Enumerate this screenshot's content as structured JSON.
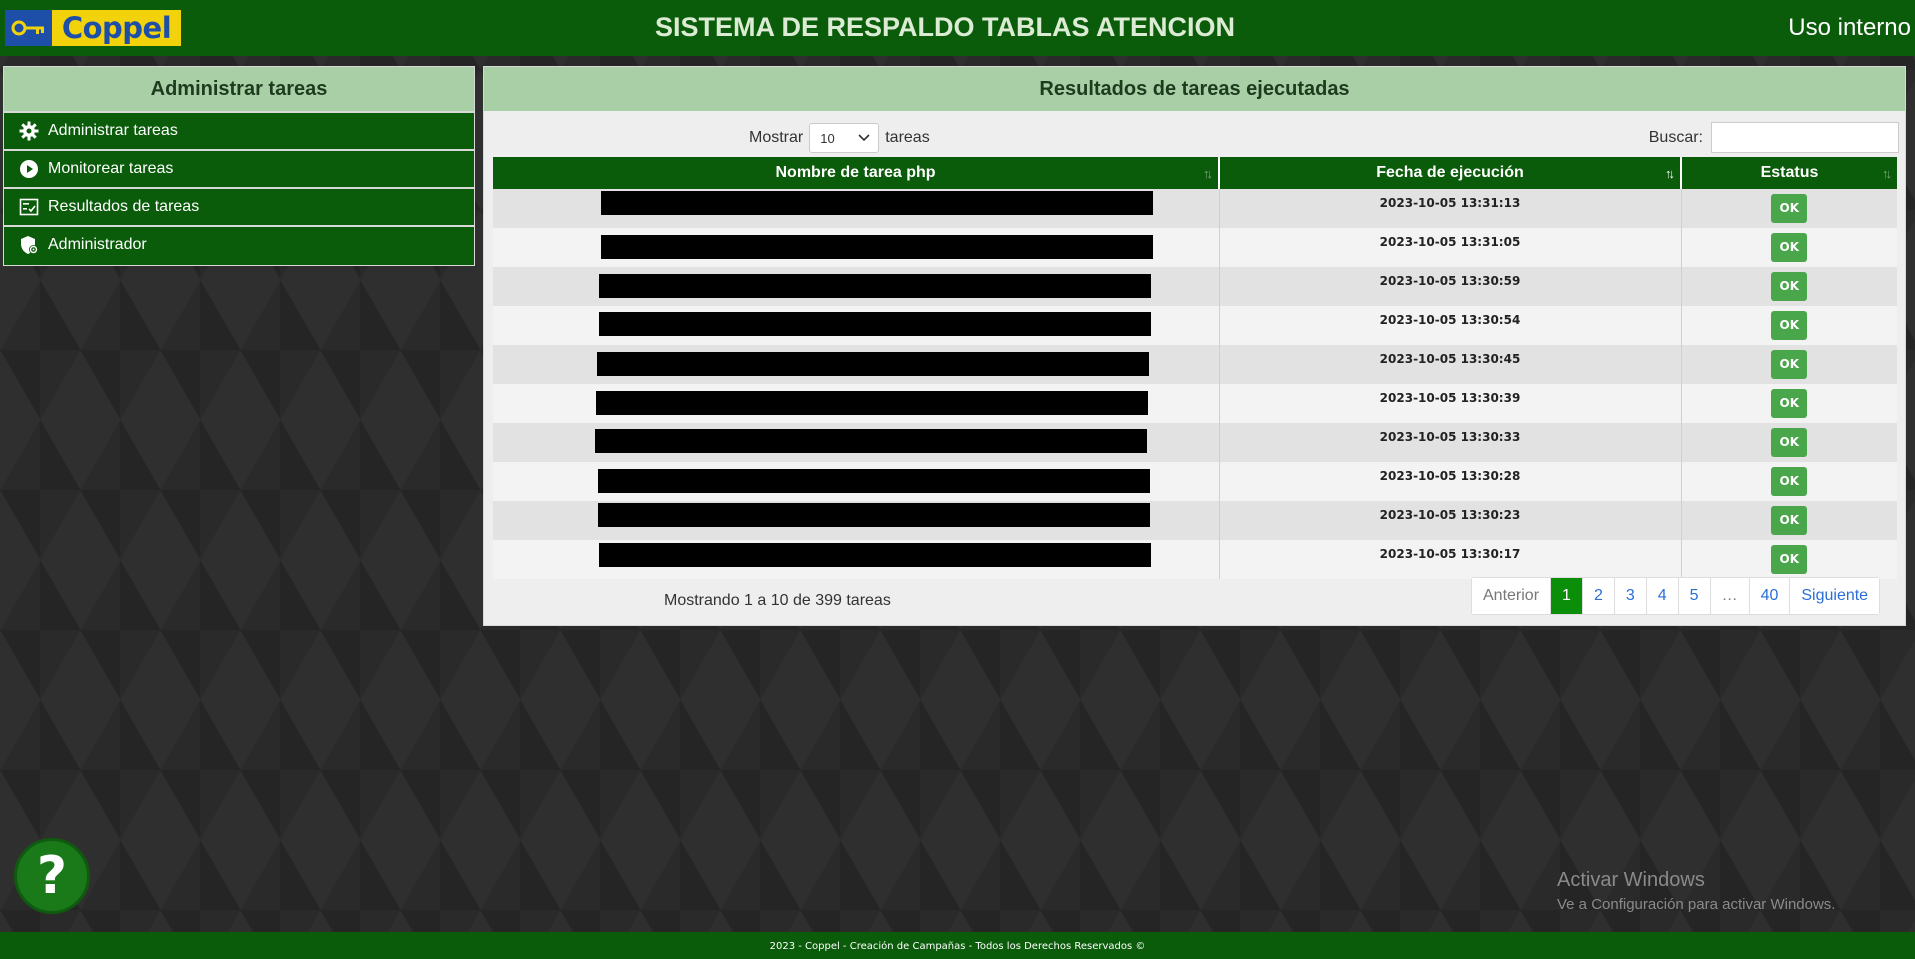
{
  "header": {
    "logo_text": "Coppel",
    "title": "SISTEMA DE RESPALDO TABLAS ATENCION",
    "scope": "Uso interno"
  },
  "sidebar": {
    "title": "Administrar tareas",
    "items": [
      {
        "label": "Administrar tareas",
        "icon": "gear-icon"
      },
      {
        "label": "Monitorear tareas",
        "icon": "play-icon"
      },
      {
        "label": "Resultados de tareas",
        "icon": "checklist-icon"
      },
      {
        "label": "Administrador",
        "icon": "shield-icon"
      }
    ]
  },
  "main": {
    "title": "Resultados de tareas ejecutadas",
    "show_prefix": "Mostrar",
    "page_size": "10",
    "show_suffix": "tareas",
    "search_label": "Buscar:",
    "search_value": "",
    "columns": [
      "Nombre de tarea php",
      "Fecha de ejecución",
      "Estatus"
    ],
    "rows": [
      {
        "name": "",
        "date": "2023-10-05 13:31:13",
        "status": "OK"
      },
      {
        "name": "",
        "date": "2023-10-05 13:31:05",
        "status": "OK"
      },
      {
        "name": "",
        "date": "2023-10-05 13:30:59",
        "status": "OK"
      },
      {
        "name": "",
        "date": "2023-10-05 13:30:54",
        "status": "OK"
      },
      {
        "name": "",
        "date": "2023-10-05 13:30:45",
        "status": "OK"
      },
      {
        "name": "",
        "date": "2023-10-05 13:30:39",
        "status": "OK"
      },
      {
        "name": "",
        "date": "2023-10-05 13:30:33",
        "status": "OK"
      },
      {
        "name": "",
        "date": "2023-10-05 13:30:28",
        "status": "OK"
      },
      {
        "name": "",
        "date": "2023-10-05 13:30:23",
        "status": "OK"
      },
      {
        "name": "",
        "date": "2023-10-05 13:30:17",
        "status": "OK"
      }
    ],
    "info": "Mostrando 1 a 10 de 399 tareas",
    "pagination": [
      "Anterior",
      "1",
      "2",
      "3",
      "4",
      "5",
      "…",
      "40",
      "Siguiente"
    ],
    "current_page": "1"
  },
  "help_label": "?",
  "watermark": {
    "line1": "Activar Windows",
    "line2": "Ve a Configuración para activar Windows."
  },
  "footer": "2023 - Coppel - Creación de Campañas - Todos los Derechos Reservados ©",
  "colors": {
    "header_green": "#0a5b0a",
    "panel_head": "#a9cfa6",
    "ok_green": "#4aa64a",
    "active_page": "#0b8f0b"
  }
}
